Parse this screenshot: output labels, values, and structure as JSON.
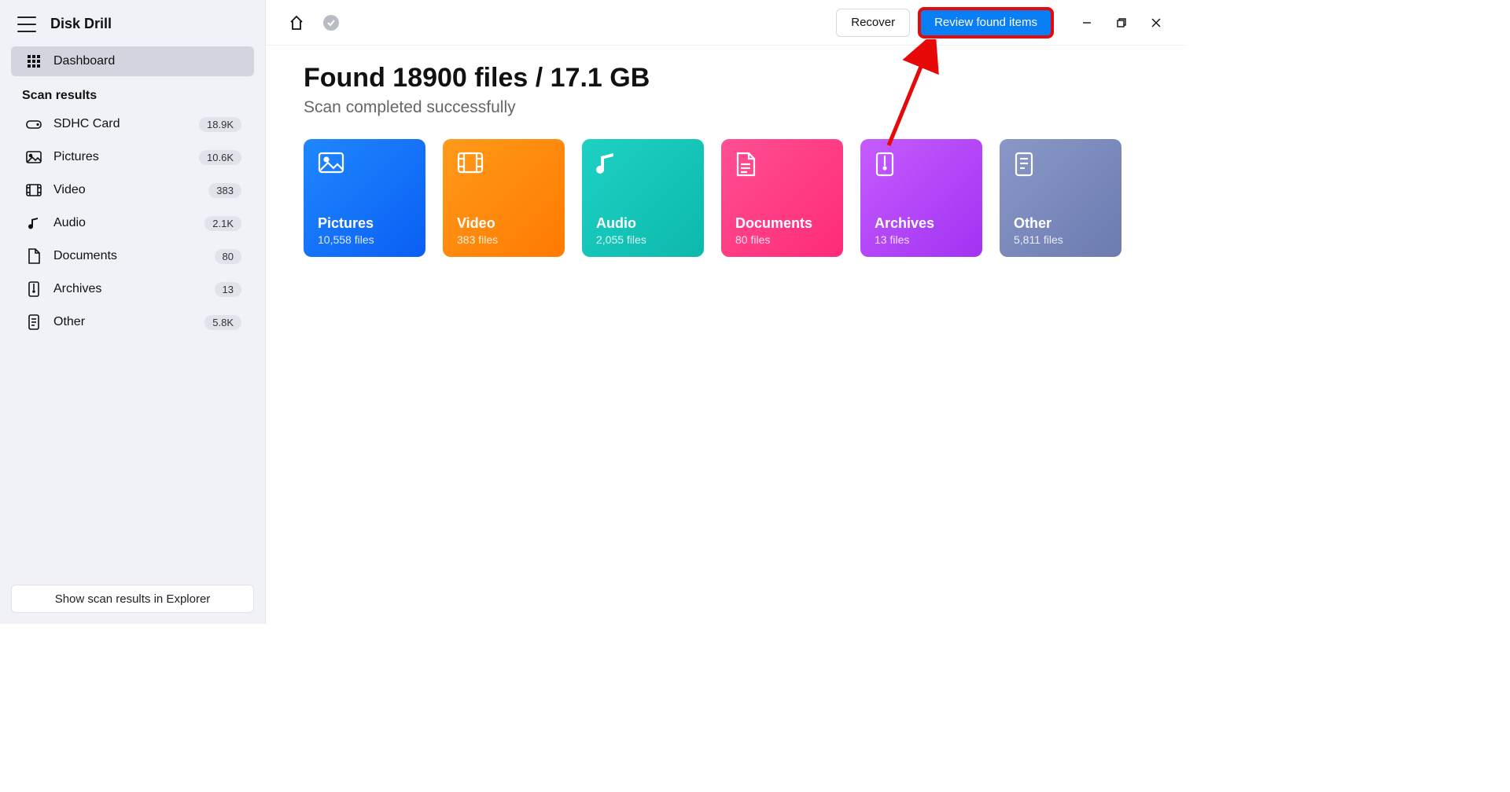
{
  "app": {
    "title": "Disk Drill"
  },
  "sidebar": {
    "dashboard_label": "Dashboard",
    "section_title": "Scan results",
    "items": [
      {
        "label": "SDHC Card",
        "badge": "18.9K"
      },
      {
        "label": "Pictures",
        "badge": "10.6K"
      },
      {
        "label": "Video",
        "badge": "383"
      },
      {
        "label": "Audio",
        "badge": "2.1K"
      },
      {
        "label": "Documents",
        "badge": "80"
      },
      {
        "label": "Archives",
        "badge": "13"
      },
      {
        "label": "Other",
        "badge": "5.8K"
      }
    ],
    "footer_button": "Show scan results in Explorer"
  },
  "toolbar": {
    "recover_label": "Recover",
    "review_label": "Review found items"
  },
  "summary": {
    "headline": "Found 18900 files / 17.1 GB",
    "status": "Scan completed successfully"
  },
  "cards": [
    {
      "title": "Pictures",
      "sub": "10,558 files"
    },
    {
      "title": "Video",
      "sub": "383 files"
    },
    {
      "title": "Audio",
      "sub": "2,055 files"
    },
    {
      "title": "Documents",
      "sub": "80 files"
    },
    {
      "title": "Archives",
      "sub": "13 files"
    },
    {
      "title": "Other",
      "sub": "5,811 files"
    }
  ]
}
